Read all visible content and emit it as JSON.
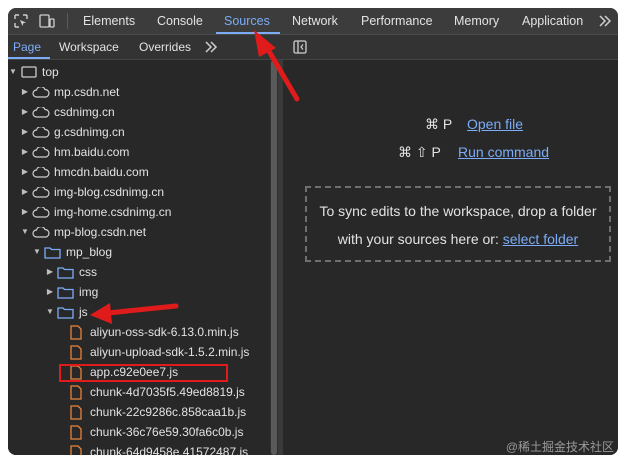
{
  "toolbar": {
    "tabs": [
      "Elements",
      "Console",
      "Sources",
      "Network",
      "Performance",
      "Memory",
      "Application"
    ],
    "active_tab": "Sources",
    "more_icon": "double-chevron-right"
  },
  "navigator": {
    "tabs": [
      "Page",
      "Workspace",
      "Overrides"
    ],
    "active_tab": "Page",
    "more_icon": "double-chevron-right"
  },
  "tree": [
    {
      "label": "top",
      "icon": "frame-icon"
    },
    {
      "label": "mp.csdn.net",
      "icon": "cloud-icon"
    },
    {
      "label": "csdnimg.cn",
      "icon": "cloud-icon"
    },
    {
      "label": "g.csdnimg.cn",
      "icon": "cloud-icon"
    },
    {
      "label": "hm.baidu.com",
      "icon": "cloud-icon"
    },
    {
      "label": "hmcdn.baidu.com",
      "icon": "cloud-icon"
    },
    {
      "label": "img-blog.csdnimg.cn",
      "icon": "cloud-icon"
    },
    {
      "label": "img-home.csdnimg.cn",
      "icon": "cloud-icon"
    },
    {
      "label": "mp-blog.csdn.net",
      "icon": "cloud-icon"
    },
    {
      "label": "mp_blog",
      "icon": "folder-icon"
    },
    {
      "label": "css",
      "icon": "folder-icon"
    },
    {
      "label": "img",
      "icon": "folder-icon"
    },
    {
      "label": "js",
      "icon": "folder-icon"
    },
    {
      "label": "aliyun-oss-sdk-6.13.0.min.js",
      "icon": "file-icon"
    },
    {
      "label": "aliyun-upload-sdk-1.5.2.min.js",
      "icon": "file-icon"
    },
    {
      "label": "app.c92e0ee7.js",
      "icon": "file-icon"
    },
    {
      "label": "chunk-4d7035f5.49ed8819.js",
      "icon": "file-icon"
    },
    {
      "label": "chunk-22c9286c.858caa1b.js",
      "icon": "file-icon"
    },
    {
      "label": "chunk-36c76e59.30fa6c0b.js",
      "icon": "file-icon"
    },
    {
      "label": "chunk-64d9458e.41572487.js",
      "icon": "file-icon"
    }
  ],
  "editor": {
    "shortcut_open_keys": "⌘ P",
    "shortcut_open_label": "Open file",
    "shortcut_run_keys": "⌘ ⇧ P",
    "shortcut_run_label": "Run command",
    "drop_line1": "To sync edits to the workspace, drop a folder",
    "drop_line2": "with your sources here or:",
    "drop_link": "select folder"
  },
  "watermark": "@稀土掘金技术社区",
  "colors": {
    "accent": "#7cacf8",
    "annotation_red": "#e01b1b",
    "file_icon": "#e8833a",
    "folder_icon": "#7cacf8"
  }
}
